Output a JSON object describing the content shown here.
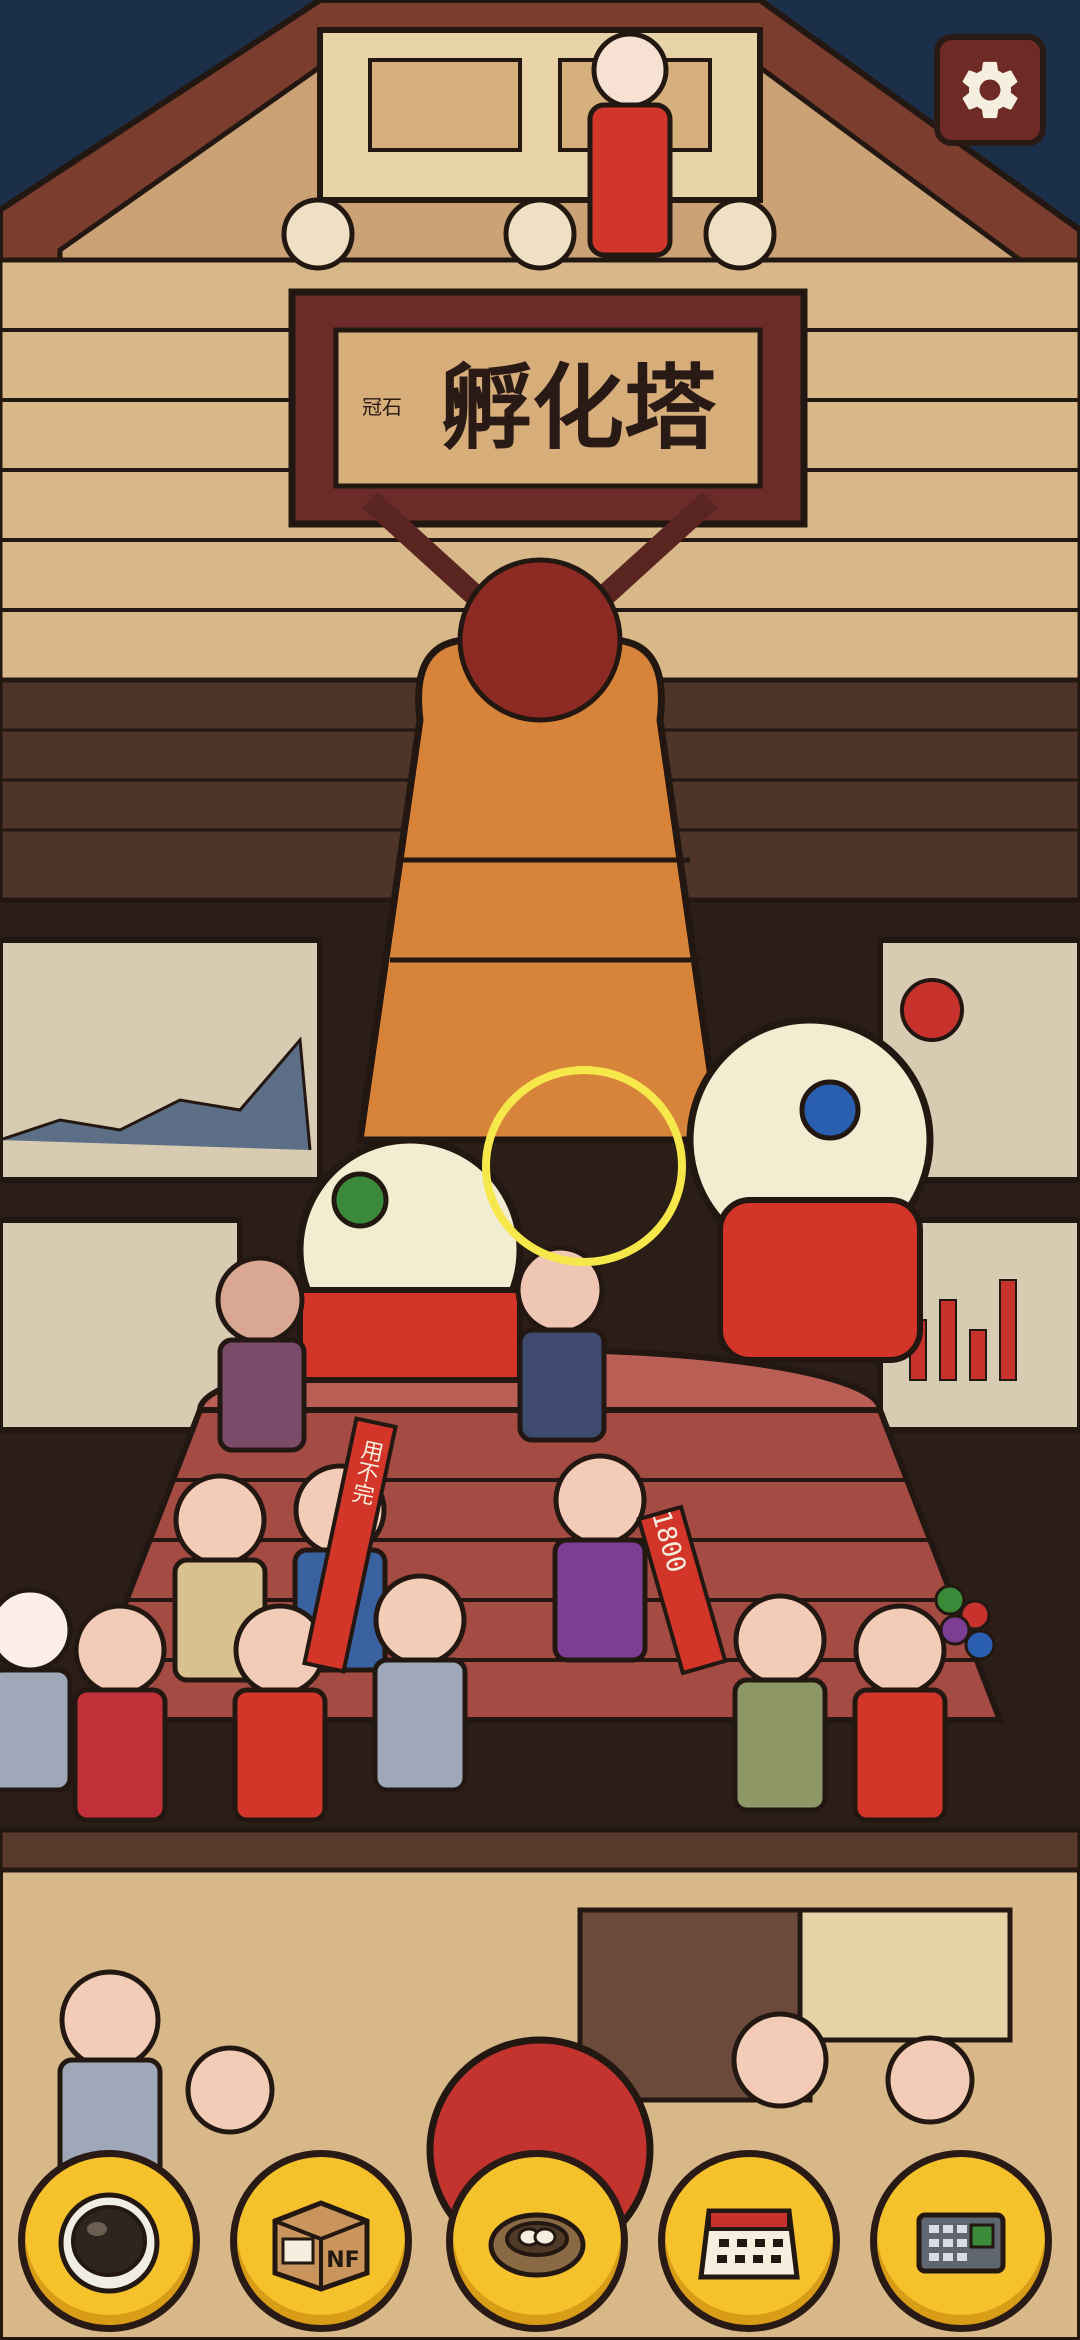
{
  "scene": {
    "signboard_text": "孵化塔",
    "signboard_small": "冠石",
    "banner_left": "用不完",
    "banner_right": "1800",
    "bottom_box_label": "NF"
  },
  "hud": {
    "settings_icon": "gear-icon",
    "highlight_color": "#f6e84a"
  },
  "toolbar": {
    "items": [
      {
        "name": "astronaut-helmet",
        "icon": "helmet-icon"
      },
      {
        "name": "package",
        "icon": "box-icon",
        "label": "NF"
      },
      {
        "name": "nest",
        "icon": "nest-icon"
      },
      {
        "name": "calendar",
        "icon": "calendar-icon"
      },
      {
        "name": "device",
        "icon": "keypad-device-icon"
      }
    ]
  }
}
